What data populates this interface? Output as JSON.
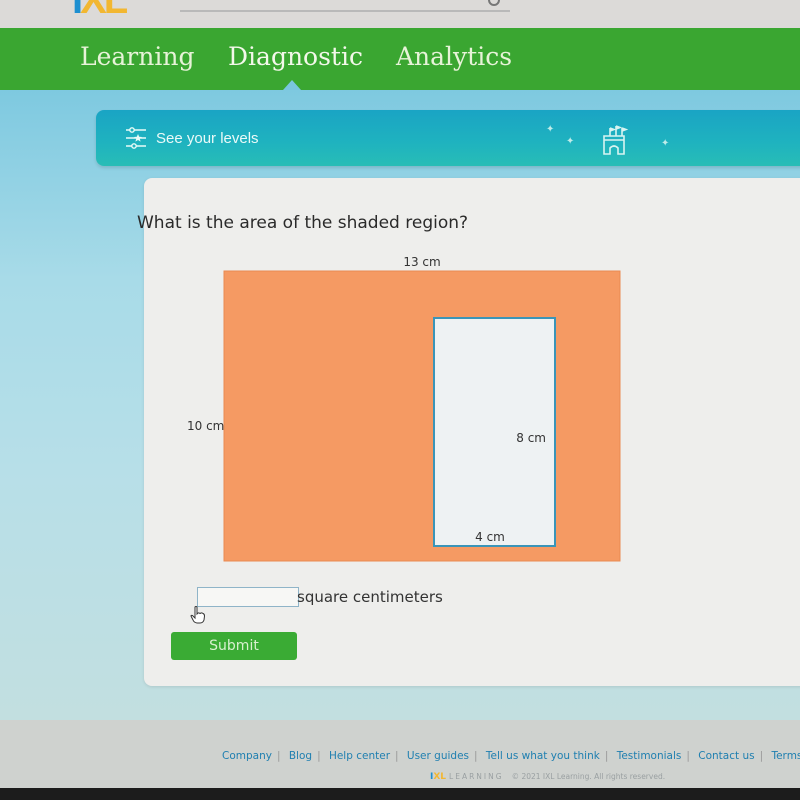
{
  "header": {
    "logo": {
      "i": "I",
      "xl": "XL"
    },
    "search_icon": "search-icon"
  },
  "nav": {
    "items": [
      {
        "label": "Learning",
        "active": false
      },
      {
        "label": "Diagnostic",
        "active": true
      },
      {
        "label": "Analytics",
        "active": false
      }
    ]
  },
  "levels_bar": {
    "label": "See your levels",
    "icon": "sliders-star-icon",
    "decoration": "castle-icon"
  },
  "question": {
    "prompt": "What is the area of the shaded region?",
    "figure": {
      "outer": {
        "width_label": "13 cm",
        "height_label": "10 cm",
        "width": 13,
        "height": 10,
        "fill": "#f59a63"
      },
      "inner": {
        "width_label": "4 cm",
        "height_label": "8 cm",
        "width": 4,
        "height": 8,
        "fill": "#eef2f3",
        "stroke": "#3a95b8"
      }
    },
    "answer": {
      "value": "",
      "placeholder": "",
      "unit": "square centimeters"
    },
    "submit_label": "Submit"
  },
  "footer": {
    "links": [
      "Company",
      "Blog",
      "Help center",
      "User guides",
      "Tell us what you think",
      "Testimonials",
      "Contact us",
      "Terms of"
    ],
    "brand": {
      "i": "I",
      "xl": "XL",
      "learning": "LEARNING"
    },
    "copyright": "© 2021 IXL Learning. All rights reserved."
  },
  "colors": {
    "nav_green": "#3aa631",
    "submit_green": "#3aab34",
    "levels_teal": "#1fb3bf",
    "shaded_orange": "#f59a63"
  }
}
